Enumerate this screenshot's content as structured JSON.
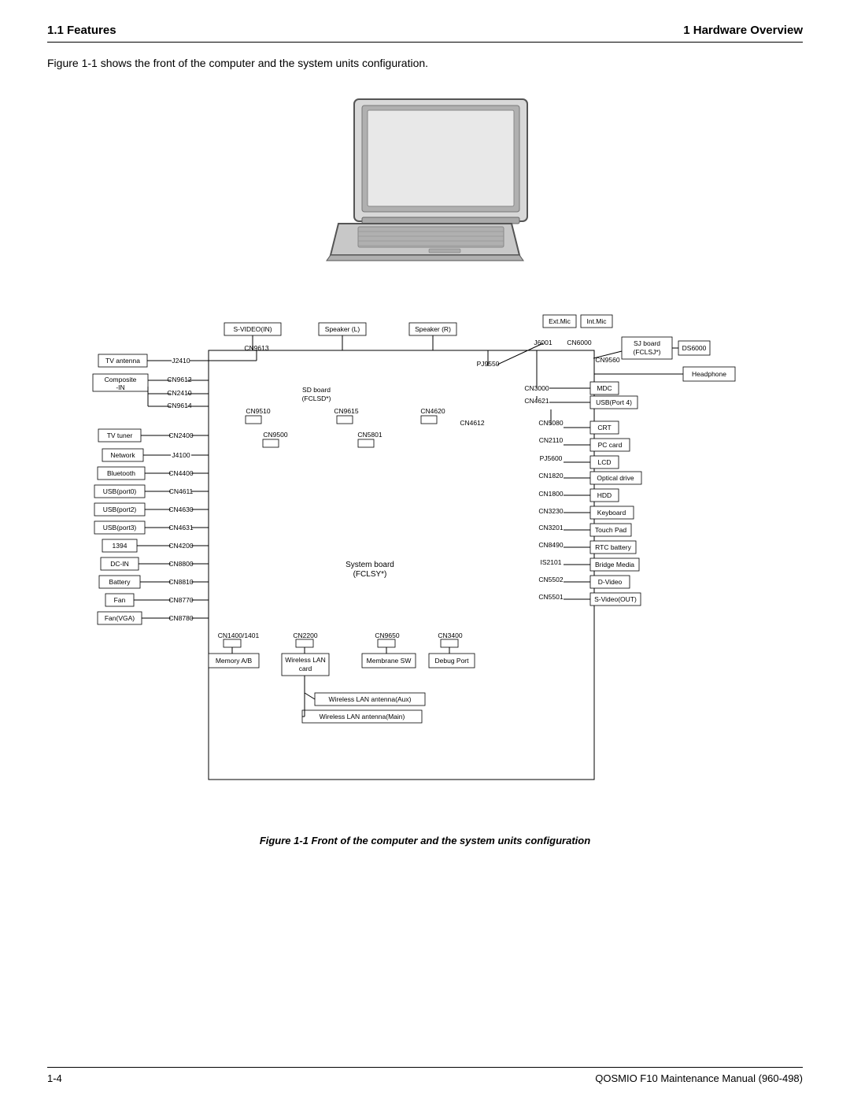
{
  "header": {
    "left": "1.1  Features",
    "right": "1  Hardware Overview"
  },
  "intro": "Figure 1-1 shows the front of the computer and the system units configuration.",
  "caption": "Figure 1-1 Front of the computer and the system units configuration",
  "footer": {
    "left": "1-4",
    "right": "QOSMIO F10  Maintenance Manual (960-498)"
  }
}
